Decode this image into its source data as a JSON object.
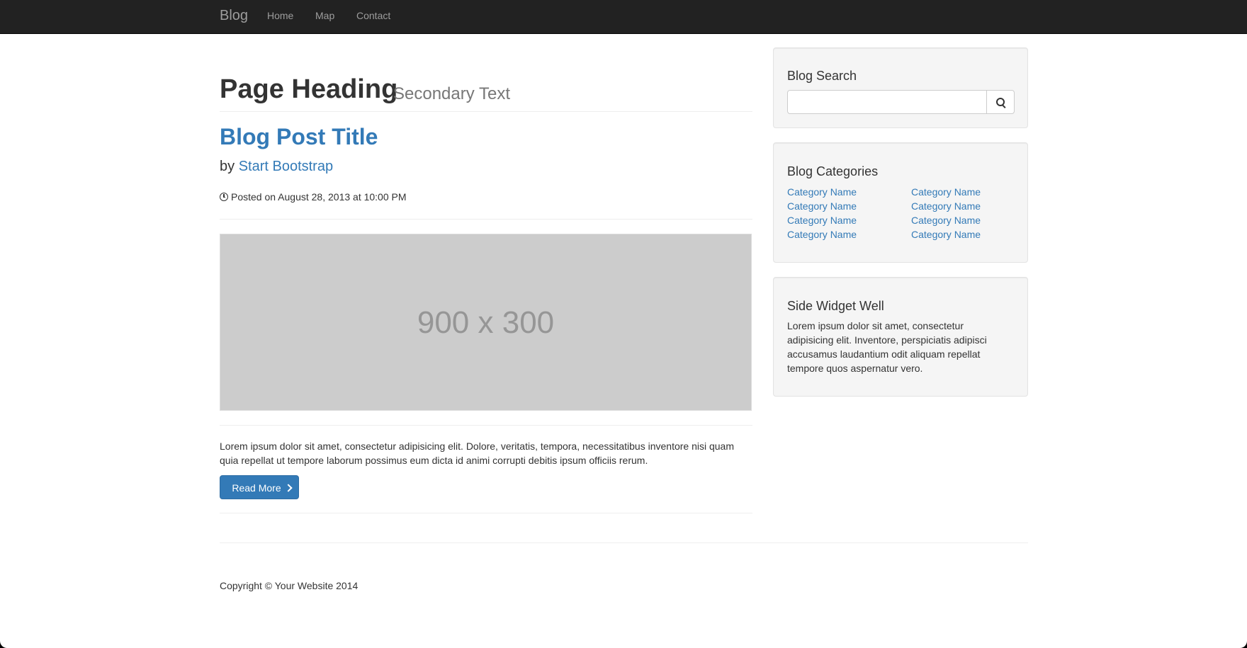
{
  "navbar": {
    "brand": "Blog",
    "links": [
      "Home",
      "Map",
      "Contact"
    ]
  },
  "header": {
    "title": "Page Heading",
    "secondary": "Secondary Text"
  },
  "post": {
    "title": "Blog Post Title",
    "by_prefix": "by",
    "author": "Start Bootstrap",
    "posted": "Posted on August 28, 2013 at 10:00 PM",
    "image_text": "900 x 300",
    "excerpt": "Lorem ipsum dolor sit amet, consectetur adipisicing elit. Dolore, veritatis, tempora, necessitatibus inventore nisi quam quia repellat ut tempore laborum possimus eum dicta id animi corrupti debitis ipsum officiis rerum.",
    "read_more": "Read More"
  },
  "sidebar": {
    "search": {
      "title": "Blog Search",
      "value": "",
      "icon": "search-icon"
    },
    "categories": {
      "title": "Blog Categories",
      "left": [
        "Category Name",
        "Category Name",
        "Category Name",
        "Category Name"
      ],
      "right": [
        "Category Name",
        "Category Name",
        "Category Name",
        "Category Name"
      ]
    },
    "widget": {
      "title": "Side Widget Well",
      "text": "Lorem ipsum dolor sit amet, consectetur adipisicing elit. Inventore, perspiciatis adipisci accusamus laudantium odit aliquam repellat tempore quos aspernatur vero."
    }
  },
  "footer": {
    "copyright": "Copyright © Your Website 2014"
  },
  "colors": {
    "navbar_bg": "#222222",
    "link": "#337ab7",
    "button_primary": "#337ab7",
    "well_bg": "#f5f5f5",
    "placeholder_bg": "#cccccc"
  }
}
